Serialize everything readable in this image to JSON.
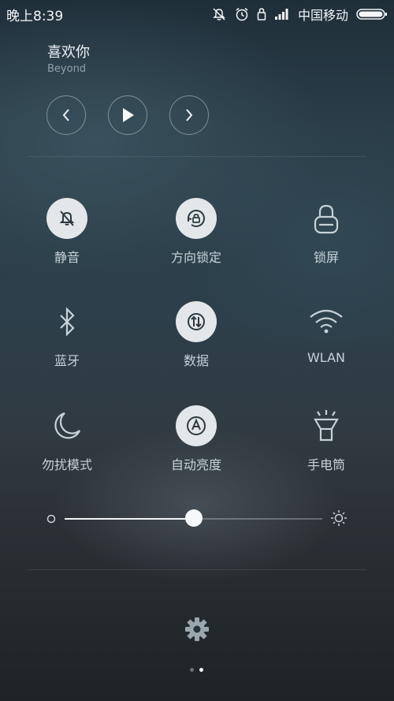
{
  "status_bar": {
    "time": "晚上8:39",
    "carrier": "中国移动",
    "icons": [
      "silent-muted-icon",
      "alarm-clock-icon",
      "lock-icon",
      "signal-icon",
      "battery-icon"
    ]
  },
  "media": {
    "title": "喜欢你",
    "artist": "Beyond",
    "controls": [
      "previous-icon",
      "play-icon",
      "next-icon"
    ]
  },
  "tiles": [
    {
      "label": "静音",
      "icon": "bell-off-icon",
      "active": true
    },
    {
      "label": "方向锁定",
      "icon": "rotation-lock-icon",
      "active": true
    },
    {
      "label": "锁屏",
      "icon": "padlock-icon",
      "active": false
    },
    {
      "label": "蓝牙",
      "icon": "bluetooth-icon",
      "active": false
    },
    {
      "label": "数据",
      "icon": "mobile-data-icon",
      "active": true
    },
    {
      "label": "WLAN",
      "icon": "wifi-icon",
      "active": false
    },
    {
      "label": "勿扰模式",
      "icon": "moon-icon",
      "active": false
    },
    {
      "label": "自动亮度",
      "icon": "auto-brightness-icon",
      "active": true
    },
    {
      "label": "手电筒",
      "icon": "flashlight-icon",
      "active": false
    }
  ],
  "brightness": {
    "level": 0.5
  },
  "pager": {
    "pages": 2,
    "current": 2
  },
  "colors": {
    "accent": "#e3e7e9",
    "label": "#c7d2d8",
    "background": "#2c3f4a"
  }
}
